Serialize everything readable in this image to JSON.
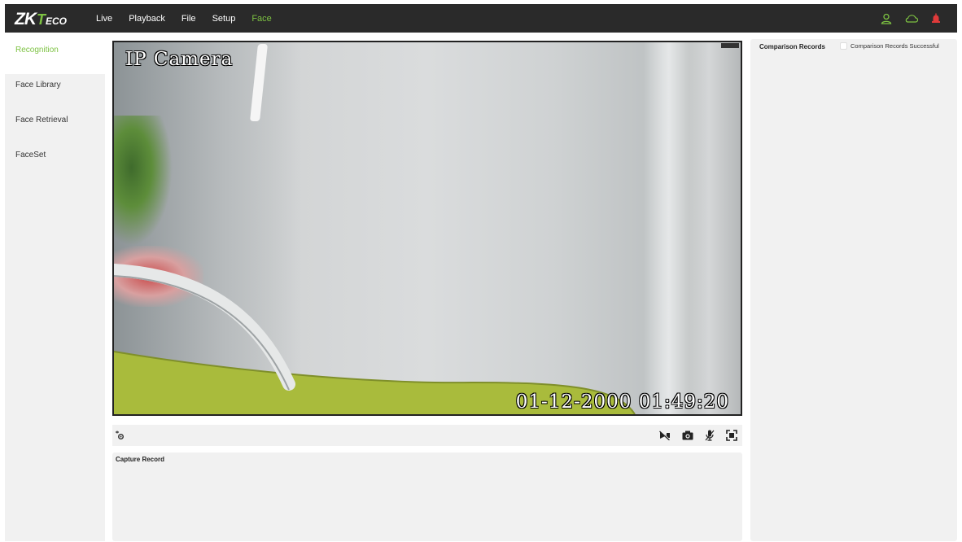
{
  "brand": {
    "logo_main": "ZK",
    "logo_t": "T",
    "logo_rest": "ECO"
  },
  "nav": {
    "items": [
      {
        "label": "Live"
      },
      {
        "label": "Playback"
      },
      {
        "label": "File"
      },
      {
        "label": "Setup"
      },
      {
        "label": "Face",
        "active": true
      }
    ]
  },
  "header_icons": [
    "user-icon",
    "cloud-icon",
    "alarm-icon"
  ],
  "sidebar": {
    "items": [
      {
        "label": "Recognition",
        "active": true
      },
      {
        "label": "Face Library"
      },
      {
        "label": "Face Retrieval"
      },
      {
        "label": "FaceSet"
      }
    ]
  },
  "video": {
    "osd_title": "IP Camera",
    "osd_timestamp": "01-12-2000 01:49:20"
  },
  "toolbar": {
    "left_icon": "settings-toggle-icon",
    "right_icons": [
      "record-off-icon",
      "snapshot-icon",
      "mic-off-icon",
      "fullscreen-icon"
    ]
  },
  "capture_panel": {
    "title": "Capture Record"
  },
  "records_panel": {
    "title": "Comparison Records",
    "filter_label": "Comparison Records Successful",
    "filter_checked": false
  },
  "colors": {
    "accent": "#7dc242",
    "topbar": "#2a2a2a",
    "panel": "#f1f1f1",
    "alarm": "#e03a3a"
  }
}
